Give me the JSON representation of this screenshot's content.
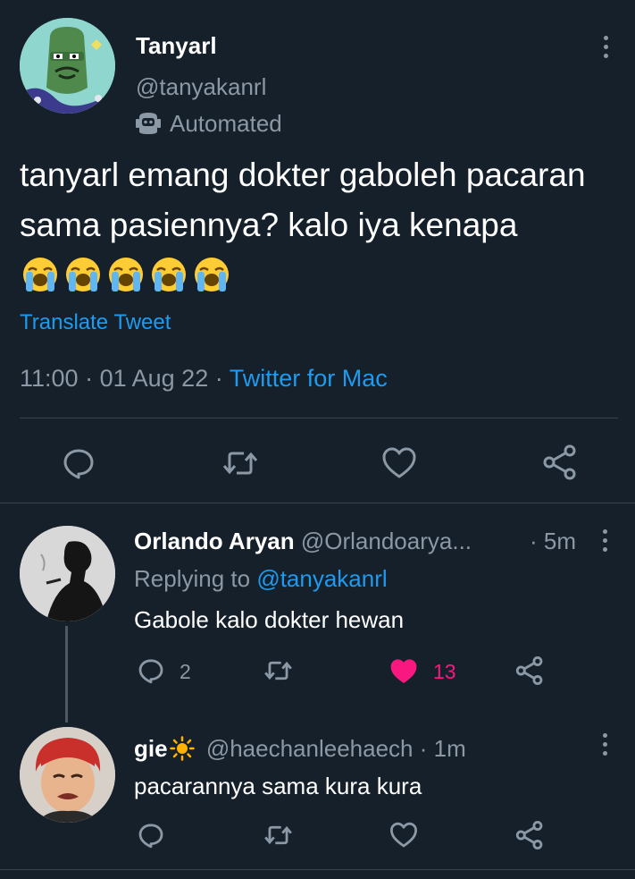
{
  "main_tweet": {
    "author_name": "Tanyarl",
    "handle": "@tanyakanrl",
    "automated_label": "Automated",
    "text": "tanyarl emang dokter gaboleh pacaran sama pasiennya? kalo iya kenapa",
    "emoji": "loudly-crying-face",
    "emoji_count": 5,
    "translate_label": "Translate Tweet",
    "time": "11:00",
    "date": "01 Aug 22",
    "separator": "·",
    "source": "Twitter for Mac",
    "actions": [
      "reply-icon",
      "retweet-icon",
      "like-icon",
      "share-icon"
    ]
  },
  "replies": [
    {
      "name": "Orlando Aryan",
      "handle": "@Orlandoarya...",
      "separator": "·",
      "time": "5m",
      "replying_prefix": "Replying to",
      "replying_to": "@tanyakanrl",
      "text": "Gabole kalo dokter hewan",
      "reply_count": "2",
      "like_count": "13",
      "liked": true,
      "like_color": "#f91880"
    },
    {
      "name": "gie",
      "name_emoji": "sun-icon",
      "handle": "@haechanleehaech",
      "separator": "·",
      "time": "1m",
      "text": "pacarannya sama kura kura"
    }
  ],
  "colors": {
    "background": "#15202b",
    "text_primary": "#ffffff",
    "text_secondary": "#8b98a5",
    "accent": "#1d9bf0",
    "like": "#f91880",
    "divider": "#38444d"
  }
}
